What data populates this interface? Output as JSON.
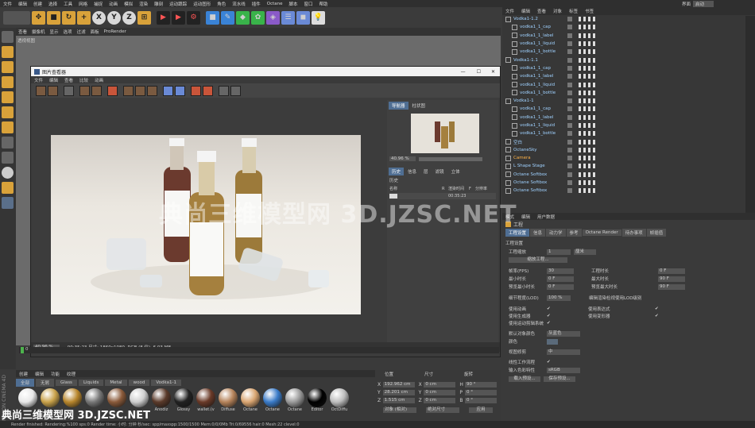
{
  "menubar": [
    "文件",
    "编辑",
    "创建",
    "选择",
    "工具",
    "网格",
    "捕捉",
    "动画",
    "模拟",
    "渲染",
    "雕刻",
    "运动跟踪",
    "运动图形",
    "角色",
    "流水线",
    "插件",
    "Octane",
    "脚本",
    "窗口",
    "帮助"
  ],
  "layout": {
    "label": "界面",
    "value": "启动"
  },
  "toolbar": {
    "x": "X",
    "y": "Y",
    "z": "Z"
  },
  "viewport": {
    "menu": [
      "查看",
      "摄像机",
      "显示",
      "选项",
      "过滤",
      "面板",
      "ProRender"
    ],
    "label": "透视视图"
  },
  "dialog": {
    "title": "图片查看器",
    "menu": [
      "文件",
      "编辑",
      "查看",
      "比较",
      "动画"
    ],
    "nav_tabs": [
      "导航器",
      "柱状图"
    ],
    "zoom": "40.96 %",
    "hist_tabs": [
      "历史",
      "信息",
      "层",
      "滤镜",
      "立体"
    ],
    "hist_label": "历史",
    "hist_cols": [
      "名称",
      "R",
      "渲染时间",
      "F",
      "分辨率"
    ],
    "hist_row": {
      "time": "00:35:23"
    },
    "status_zoom": "40.96 %",
    "status_info": "00:35:23    尺寸: 1860x1080, RGB (8 位), 6.03 MB"
  },
  "timeline": {
    "frame": "0"
  },
  "objects": {
    "tabs": [
      "文件",
      "编辑",
      "查看",
      "对象",
      "标签",
      "书签"
    ],
    "rows": [
      {
        "name": "Vodka1-1.2",
        "level": 0,
        "color": "#9fd1ff"
      },
      {
        "name": "vodka1_1_cap",
        "level": 1,
        "color": "#9fd1ff"
      },
      {
        "name": "vodka1_1_label",
        "level": 1,
        "color": "#9fd1ff"
      },
      {
        "name": "vodka1_1_liquid",
        "level": 1,
        "color": "#9fd1ff"
      },
      {
        "name": "vodka1_1_bottle",
        "level": 1,
        "color": "#9fd1ff"
      },
      {
        "name": "Vodka1-1.1",
        "level": 0,
        "color": "#9fd1ff"
      },
      {
        "name": "vodka1_1_cap",
        "level": 1,
        "color": "#9fd1ff"
      },
      {
        "name": "vodka1_1_label",
        "level": 1,
        "color": "#9fd1ff"
      },
      {
        "name": "vodka1_1_liquid",
        "level": 1,
        "color": "#9fd1ff"
      },
      {
        "name": "vodka1_1_bottle",
        "level": 1,
        "color": "#9fd1ff"
      },
      {
        "name": "Vodka1-1",
        "level": 0,
        "color": "#9fd1ff"
      },
      {
        "name": "vodka1_1_cap",
        "level": 1,
        "color": "#9fd1ff"
      },
      {
        "name": "vodka1_1_label",
        "level": 1,
        "color": "#9fd1ff"
      },
      {
        "name": "vodka1_1_liquid",
        "level": 1,
        "color": "#9fd1ff"
      },
      {
        "name": "vodka1_1_bottle",
        "level": 1,
        "color": "#9fd1ff"
      },
      {
        "name": "空白",
        "level": 0,
        "color": "#9fd1ff"
      },
      {
        "name": "OctaneSky",
        "level": 0,
        "color": "#9fd1ff"
      },
      {
        "name": "Camera",
        "level": 0,
        "color": "#ffb347"
      },
      {
        "name": "L Shape Stage",
        "level": 0,
        "color": "#9fd1ff"
      },
      {
        "name": "Octane Softbox",
        "level": 0,
        "color": "#9fd1ff"
      },
      {
        "name": "Octane Softbox",
        "level": 0,
        "color": "#9fd1ff"
      },
      {
        "name": "Octane Softbox",
        "level": 0,
        "color": "#9fd1ff"
      }
    ]
  },
  "attributes": {
    "tabs": [
      "模式",
      "编辑",
      "用户数据"
    ],
    "title": "工程",
    "subtabs": [
      "工程设置",
      "信息",
      "动力学",
      "参考",
      "Octane Render",
      "待办事项",
      "帧插值"
    ],
    "section": "工程设置",
    "scale_label": "工程缩放",
    "scale_value": "1",
    "scale_unit": "厘米",
    "scale_btn": "缩放工程...",
    "fields_left": [
      [
        "帧率(FPS)",
        "30"
      ],
      [
        "最小时长",
        "0 F"
      ],
      [
        "预览最小时长",
        "0 F"
      ]
    ],
    "fields_right": [
      [
        "工程时长",
        "0 F"
      ],
      [
        "最大时长",
        "90 F"
      ],
      [
        "预览最大时长",
        "90 F"
      ]
    ],
    "lod_label": "细节程度(LOD)",
    "lod_value": "100 %",
    "lod_right": "编辑渲染检视使用LOD级别",
    "checks_left": [
      "使用动画",
      "使用生成器",
      "使用运动剪辑系统"
    ],
    "checks_right": [
      "使用表达式",
      "使用变形器"
    ],
    "default_color_label": "默认对象颜色",
    "default_color_value": "灰蓝色",
    "color_label": "颜色",
    "view_clip_label": "视图修剪",
    "view_clip_value": "中",
    "linear_label": "线性工作流程",
    "input_color_label": "输入色彩特性",
    "input_color_value": "sRGB",
    "btn_load": "载入预设...",
    "btn_save": "保存预设..."
  },
  "materials": {
    "tabs": [
      "创建",
      "编辑",
      "功能",
      "纹理"
    ],
    "filters": [
      "全部",
      "无屑",
      "Glass",
      "Liquids",
      "Metal",
      "wood",
      "Vodka1-1"
    ],
    "items": [
      {
        "label": "",
        "color": "#e8e8e8"
      },
      {
        "label": "",
        "color": "#c9a24a"
      },
      {
        "label": "",
        "color": "#b8862c"
      },
      {
        "label": "",
        "color": "#777"
      },
      {
        "label": "",
        "color": "#8a5a3a"
      },
      {
        "label": "",
        "color": "#cfcfcf"
      },
      {
        "label": "Anodiz",
        "color": "#5a3a2a"
      },
      {
        "label": "Glossy",
        "color": "#222"
      },
      {
        "label": "wallet.(v",
        "color": "#6a3a28"
      },
      {
        "label": "Diffuse",
        "color": "#b5835a"
      },
      {
        "label": "Octane",
        "color": "#d9a571"
      },
      {
        "label": "Octane",
        "color": "#3a7bc8"
      },
      {
        "label": "Octane",
        "color": "#9a9a9a"
      },
      {
        "label": "Editor",
        "color": "#000"
      },
      {
        "label": "OctDiffu",
        "color": "#bdbdbd"
      }
    ]
  },
  "coords": {
    "headers": [
      "位置",
      "尺寸",
      "旋转"
    ],
    "rows": [
      [
        "X",
        "192.962 cm",
        "X",
        "0 cm",
        "H",
        "90 °"
      ],
      [
        "Y",
        "28.201 cm",
        "Y",
        "0 cm",
        "P",
        "0 °"
      ],
      [
        "Z",
        "1.515 cm",
        "Z",
        "0 cm",
        "B",
        "0 °"
      ]
    ],
    "mode1": "对象 (相对)",
    "mode2": "绝对尺寸",
    "apply": "应用"
  },
  "status": "Render finished: Rendering:%100 sps:0 Render time: 小时: 分钟  秒/sec: spp/maxspp:1500/1500 Mem:0/0/0Mb Tri:0/69556 hair:0 Mesh:22 clevel:0",
  "watermark": "典尚三维模型网 3D.JZSC.NET",
  "watermark2": "典尚三维模型网 3D.JZSC.NET",
  "brand": "MAXON CINEMA 4D"
}
